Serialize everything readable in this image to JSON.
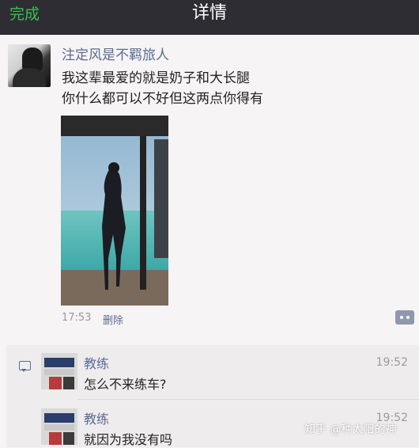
{
  "header": {
    "done_label": "完成",
    "title": "详情"
  },
  "post": {
    "author": "注定风是不羁旅人",
    "lines": [
      "我这辈最爱的就是奶子和大长腿",
      "你什么都可以不好但这两点你得有"
    ],
    "time": "17:53",
    "delete_label": "删除"
  },
  "comments": [
    {
      "name": "教练",
      "time": "19:52",
      "text": "怎么不来练车?"
    },
    {
      "name": "教练",
      "time": "19:52",
      "text": "就因为我没有吗"
    }
  ],
  "watermark": "知乎 @种太阳的神",
  "colors": {
    "accent_green": "#3dbd52",
    "link_blue": "#5a6b90",
    "topbar": "#2e2d33"
  }
}
